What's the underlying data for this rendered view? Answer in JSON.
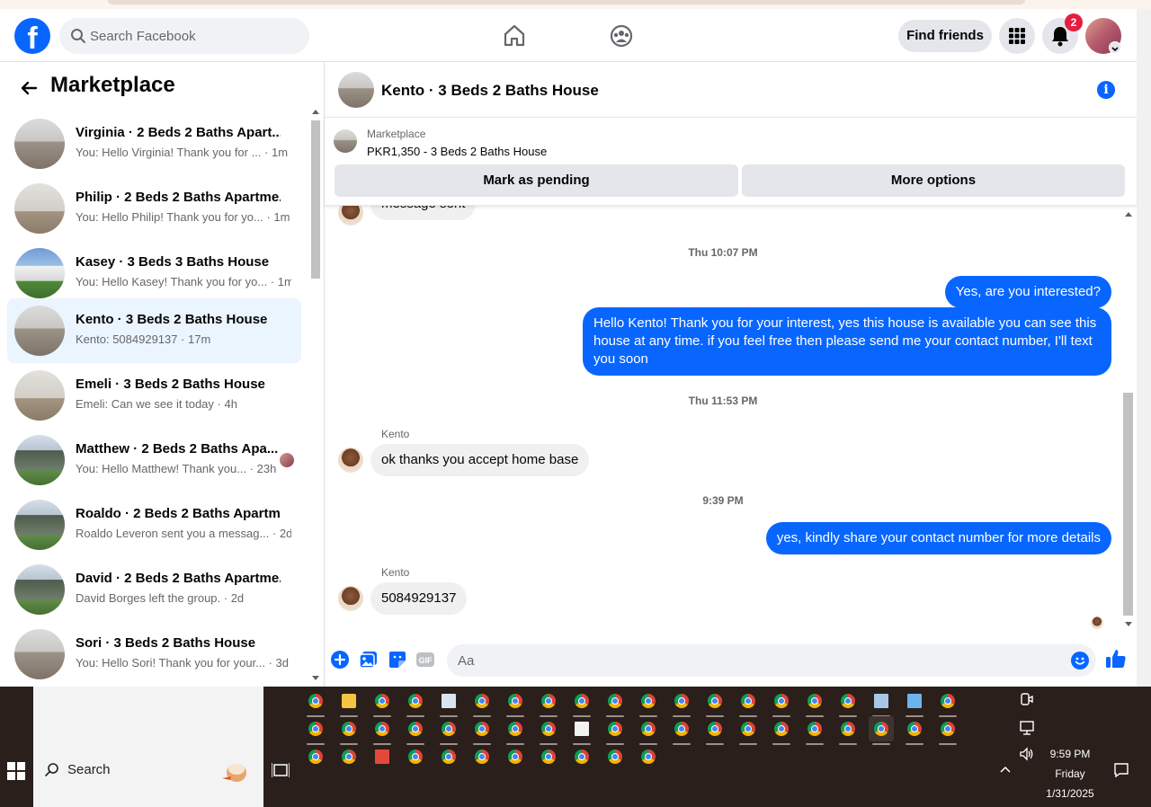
{
  "header": {
    "search_placeholder": "Search Facebook",
    "find_friends": "Find friends",
    "notification_count": "2"
  },
  "sidebar": {
    "title": "Marketplace",
    "conversations": [
      {
        "name": "Virginia · 2 Beds 2 Baths Apart...",
        "snippet": "You: Hello Virginia! Thank you for ... · 1m",
        "active": false
      },
      {
        "name": "Philip · 2 Beds 2 Baths Apartme...",
        "snippet": "You: Hello Philip! Thank you for yo... · 1m",
        "active": false
      },
      {
        "name": "Kasey · 3 Beds 3 Baths House",
        "snippet": "You: Hello Kasey! Thank you for yo... · 1m",
        "active": false
      },
      {
        "name": "Kento · 3 Beds 2 Baths House",
        "snippet": "Kento: 5084929137 · 17m",
        "active": true
      },
      {
        "name": "Emeli · 3 Beds 2 Baths House",
        "snippet": "Emeli: Can we see it today · 4h",
        "active": false
      },
      {
        "name": "Matthew · 2 Beds 2 Baths Apa...",
        "snippet": "You: Hello Matthew! Thank you... · 23h",
        "active": false
      },
      {
        "name": "Roaldo · 2 Beds 2 Baths Apartm...",
        "snippet": "Roaldo Leveron sent you a messag... · 2d",
        "active": false
      },
      {
        "name": "David · 2 Beds 2 Baths Apartme...",
        "snippet": "David Borges left the group. · 2d",
        "active": false
      },
      {
        "name": "Sori · 3 Beds 2 Baths House",
        "snippet": "You: Hello Sori! Thank you for your... · 3d",
        "active": false
      }
    ]
  },
  "chat": {
    "title": "Kento · 3 Beds 2 Baths House",
    "listing": {
      "label": "Marketplace",
      "price_line": "PKR1,350 - 3 Beds 2 Baths House",
      "mark_pending": "Mark as pending",
      "more_options": "More options"
    },
    "messages": {
      "partial_in": "message sent",
      "ts1": "Thu 10:07 PM",
      "out1": "Yes, are you interested?",
      "out2": "Hello Kento! Thank you for your interest, yes this house is available you can see this house at any time. if you feel free then please send me your contact number, I'll text you soon",
      "ts2": "Thu 11:53 PM",
      "sender1": "Kento",
      "in1": "ok thanks you accept home base",
      "ts3": "9:39 PM",
      "out3": "yes, kindly share your contact number for more details",
      "sender2": "Kento",
      "in2": "5084929137"
    },
    "composer_placeholder": "Aa"
  },
  "taskbar": {
    "search_label": "Search",
    "time": "9:59 PM",
    "day": "Friday",
    "date": "1/31/2025"
  },
  "colors": {
    "brand_blue": "#0866ff",
    "active_conversation_bg": "#ebf5ff",
    "badge_red": "#e41e3f"
  }
}
